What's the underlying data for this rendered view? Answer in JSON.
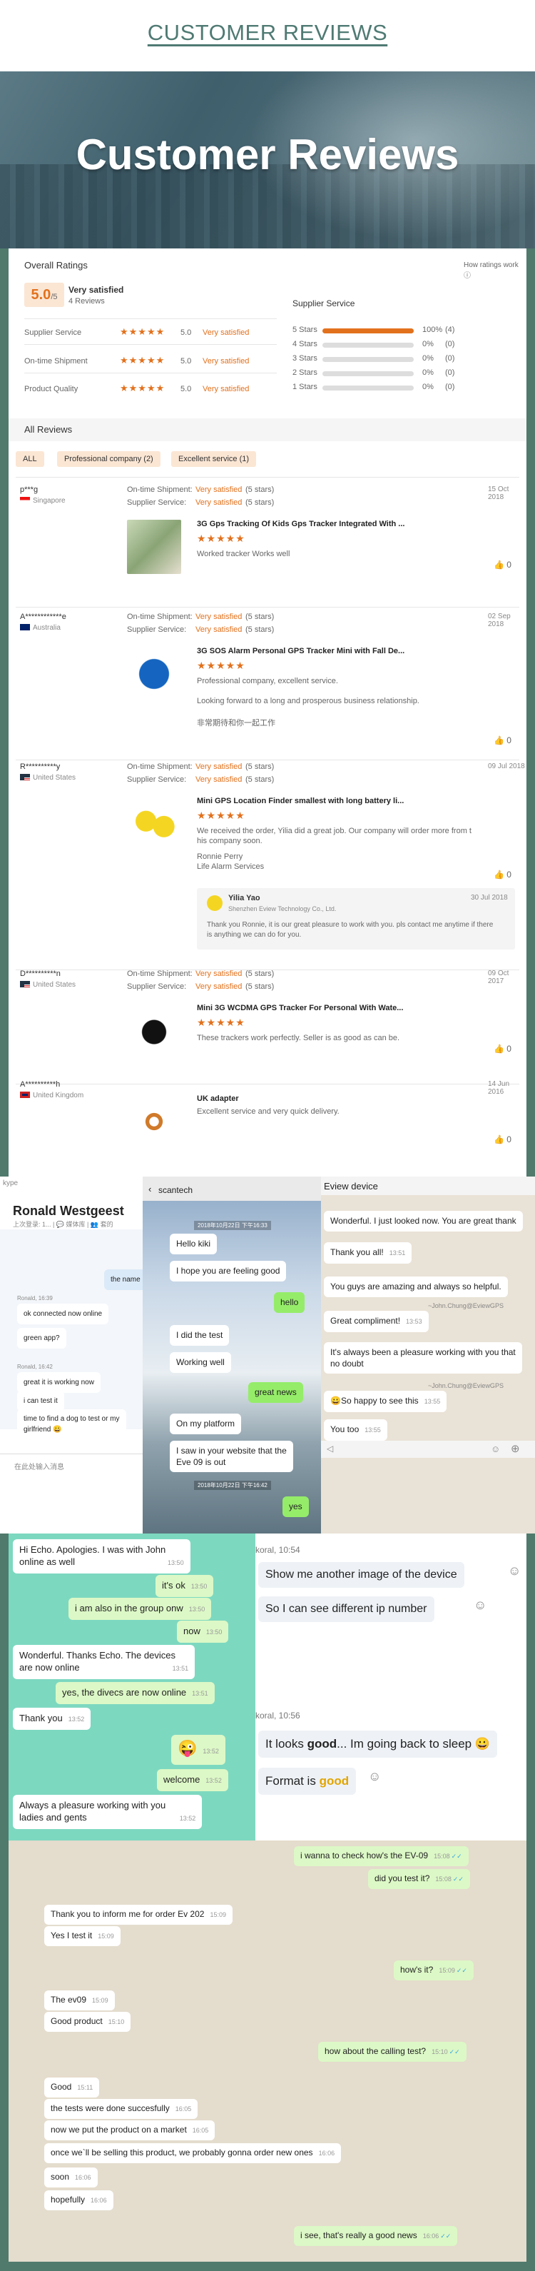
{
  "page": {
    "title": "CUSTOMER REVIEWS",
    "hero": "Customer Reviews"
  },
  "overall": {
    "heading": "Overall Ratings",
    "how": "How ratings work",
    "score": "5.0",
    "outof": "/5",
    "satisfaction": "Very satisfied",
    "count": "4 Reviews",
    "rows": [
      {
        "label": "Supplier Service",
        "value": "5.0",
        "text": "Very satisfied"
      },
      {
        "label": "On-time Shipment",
        "value": "5.0",
        "text": "Very satisfied"
      },
      {
        "label": "Product Quality",
        "value": "5.0",
        "text": "Very satisfied"
      }
    ],
    "dist_title": "Supplier Service",
    "dist": [
      {
        "label": "5 Stars",
        "pct": "100%",
        "n": "(4)",
        "frac": 1
      },
      {
        "label": "4 Stars",
        "pct": "0%",
        "n": "(0)",
        "frac": 0
      },
      {
        "label": "3 Stars",
        "pct": "0%",
        "n": "(0)",
        "frac": 0
      },
      {
        "label": "2 Stars",
        "pct": "0%",
        "n": "(0)",
        "frac": 0
      },
      {
        "label": "1 Stars",
        "pct": "0%",
        "n": "(0)",
        "frac": 0
      }
    ]
  },
  "all": {
    "heading": "All Reviews",
    "filters": [
      "ALL",
      "Professional company (2)",
      "Excellent service (1)"
    ]
  },
  "reviews": [
    {
      "user": "p***g",
      "country": "Singapore",
      "date": "15 Oct 2018",
      "ship_label": "On-time Shipment:",
      "ship": "Very satisfied",
      "ship_stars": "(5 stars)",
      "sup_label": "Supplier Service:",
      "sup": "Very satisfied",
      "sup_stars": "(5 stars)",
      "product": "3G Gps Tracking Of Kids Gps Tracker Integrated With ...",
      "text1": "Worked tracker Works well",
      "text2": "",
      "text3": "",
      "likes": "0"
    },
    {
      "user": "A************e",
      "country": "Australia",
      "date": "02 Sep 2018",
      "ship_label": "On-time Shipment:",
      "ship": "Very satisfied",
      "ship_stars": "(5 stars)",
      "sup_label": "Supplier Service:",
      "sup": "Very satisfied",
      "sup_stars": "(5 stars)",
      "product": "3G SOS Alarm Personal GPS Tracker Mini with Fall De...",
      "text1": "Professional company, excellent service.",
      "text2": "Looking forward to a long and prosperous business relationship.",
      "text3": "非常期待和你一起工作",
      "likes": "0"
    },
    {
      "user": "R**********y",
      "country": "United States",
      "date": "09 Jul 2018",
      "ship_label": "On-time Shipment:",
      "ship": "Very satisfied",
      "ship_stars": "(5 stars)",
      "sup_label": "Supplier Service:",
      "sup": "Very satisfied",
      "sup_stars": "(5 stars)",
      "product": "Mini GPS Location Finder smallest with long battery li...",
      "text1": "We received the order, Yilia did a great job. Our company will order more from t",
      "text1b": "his company soon.",
      "text2": "Ronnie Perry",
      "text3": "Life Alarm Services",
      "likes": "0",
      "reply": {
        "name": "Yilia Yao",
        "company": "Shenzhen Eview Technology Co., Ltd.",
        "date": "30 Jul 2018",
        "text": "Thank you Ronnie, it is our great pleasure to work with you. pls contact me anytime if there",
        "text2": "is anything we can do for you."
      }
    },
    {
      "user": "D**********n",
      "country": "United States",
      "date": "09 Oct 2017",
      "ship_label": "On-time Shipment:",
      "ship": "Very satisfied",
      "ship_stars": "(5 stars)",
      "sup_label": "Supplier Service:",
      "sup": "Very satisfied",
      "sup_stars": "(5 stars)",
      "product": "Mini 3G WCDMA GPS Tracker For Personal With Wate...",
      "text1": "These trackers work perfectly. Seller is as good as can be.",
      "likes": "0"
    },
    {
      "user": "A**********h",
      "country": "United Kingdom",
      "date": "14 Jun 2016",
      "product": "UK adapter",
      "text1": "Excellent service and very quick delivery.",
      "likes": "0"
    }
  ],
  "chat1": {
    "app": "kype",
    "name": "Ronald Westgeest",
    "sub": "上次登录: 1...  | 💬 媒体库  |  👥 套的",
    "m1": "the name",
    "s1": "Ronald, 16:39",
    "m2": "ok connected now online",
    "m3": "green app?",
    "s2": "Ronald, 16:42",
    "m4": "great it is working now",
    "m5": "i can test it",
    "m6": "time to find a dog to test or my",
    "m6b": "girlfriend 😀",
    "input": "在此处输入消息"
  },
  "chat2": {
    "title": "scantech",
    "ts1": "2018年10月22日 下午16:33",
    "m1": "Hello kiki",
    "m2": "I hope you are feeling good",
    "m3": "hello",
    "m4": "I did the test",
    "m5": "Working well",
    "m6": "great news",
    "m7": "On my platform",
    "m8": "I saw in your website that the",
    "m8b": "Eve 09 is out",
    "ts2": "2018年10月22日 下午16:42",
    "m9": "yes"
  },
  "chat3": {
    "title": "Eview device",
    "m1": "Wonderful. I just looked now. You are great thank",
    "m2": "Thank you all!",
    "t2": "13:51",
    "m3": "You guys are amazing and always so helpful.",
    "q1": "~John.Chung@EviewGPS",
    "m4": "Great compliment!",
    "t4": "13:53",
    "m5": "It's always been a pleasure working with you that",
    "m5b": "no doubt",
    "q2": "~John.Chung@EviewGPS",
    "m6": "😀So happy to see this",
    "t6": "13:55",
    "m7": "You too",
    "t7": "13:55"
  },
  "chat4": {
    "m1": "Hi Echo. Apologies. I was with John",
    "m1b": "online as well",
    "t1": "13:50",
    "m2": "it's ok",
    "t2": "13:50",
    "m3": "i am also in the group onw",
    "t3": "13:50",
    "m4": "now",
    "t4": "13:50",
    "m5": "Wonderful. Thanks Echo. The devices",
    "m5b": "are now online",
    "t5": "13:51",
    "m6": "yes, the divecs are now online",
    "t6": "13:51",
    "m7": "Thank you",
    "t7": "13:52",
    "m8": "😜",
    "t8": "13:52",
    "m9": "welcome",
    "t9": "13:52",
    "m10": "Always a pleasure working with you",
    "m10b": "ladies and gents",
    "t10": "13:52"
  },
  "chat5": {
    "s1": "koral, 10:54",
    "m1": "Show me another image of the device",
    "m2": "So I can see different ip number",
    "s2": "koral, 10:56",
    "m3a": "It looks ",
    "m3b": "good",
    "m3c": "... Im going back to sleep 😀",
    "m4a": "Format is ",
    "m4b": "good"
  },
  "chat6": {
    "m1": "i wanna to check how's the EV-09",
    "t1": "15:08",
    "m2": "did you test it?",
    "t2": "15:08",
    "m3": "Thank you to inform me for order Ev 202",
    "t3": "15:09",
    "m4": "Yes I test it",
    "t4": "15:09",
    "m5": "how's it?",
    "t5": "15:09",
    "m6": "The ev09",
    "t6": "15:09",
    "m7": "Good product",
    "t7": "15:10",
    "m8": "how about the calling test?",
    "t8": "15:10",
    "m9": "Good",
    "t9": "15:11",
    "m10": "the tests were done succesfully",
    "t10": "16:05",
    "m11": "now we put the product on a market",
    "t11": "16:05",
    "m12": "once we`ll be selling this product, we probably gonna order new ones",
    "t12": "16:06",
    "m13": "soon",
    "t13": "16:06",
    "m14": "hopefully",
    "t14": "16:06",
    "m15": "i see, that's really a good news",
    "t15": "16:06"
  }
}
